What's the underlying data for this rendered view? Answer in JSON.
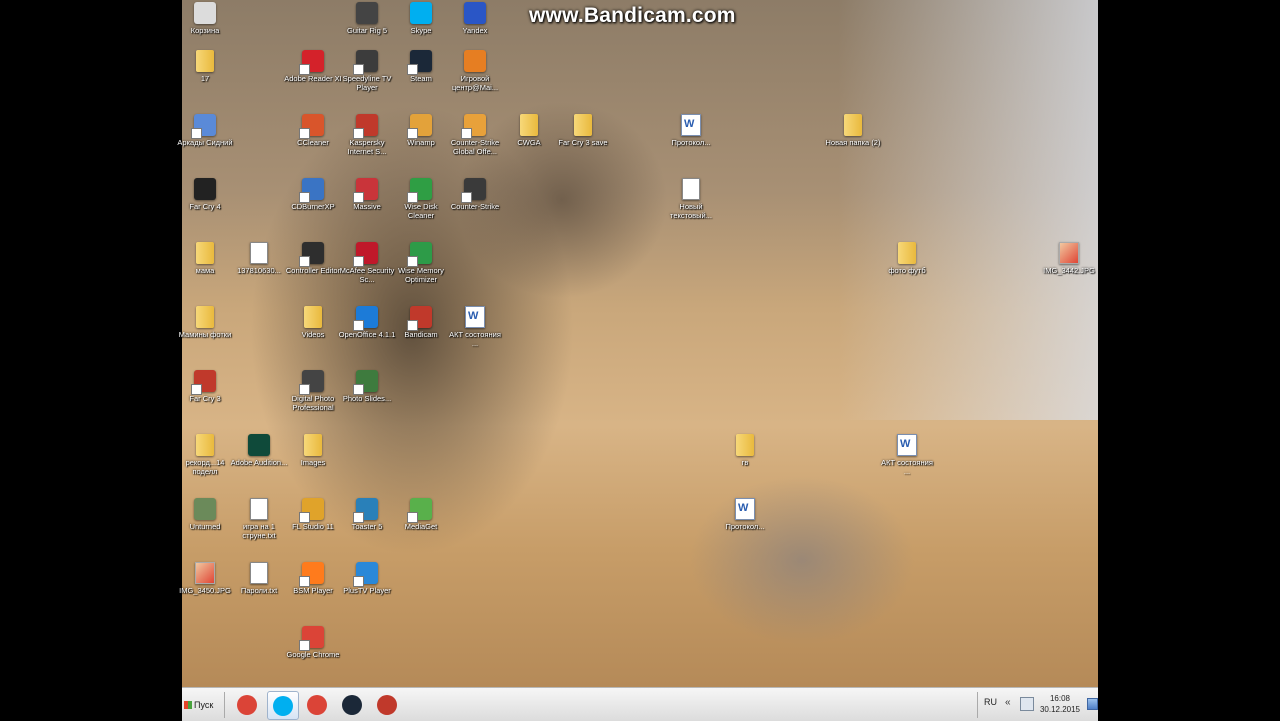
{
  "watermark": "www.Bandicam.com",
  "desktop_icons": [
    {
      "label": "Корзина",
      "type": "app",
      "color": "#dcdcdc"
    },
    {
      "label": "17",
      "type": "folder"
    },
    {
      "label": "Аркады Сидний",
      "type": "app",
      "color": "#5a8ad8",
      "shortcut": true
    },
    {
      "label": "Far Cry 4",
      "type": "app",
      "color": "#222222"
    },
    {
      "label": "мама",
      "type": "folder"
    },
    {
      "label": "Мамины фотки",
      "type": "folder"
    },
    {
      "label": "Far Cry 3",
      "type": "app",
      "color": "#c0392b",
      "shortcut": true
    },
    {
      "label": "рекорд...14 поделл",
      "type": "folder"
    },
    {
      "label": "Unturned",
      "type": "app",
      "color": "#6b8a5a"
    },
    {
      "label": "IMG_3450.JPG",
      "type": "image"
    },
    {
      "label": "Guitar Rig 5",
      "type": "app",
      "color": "#444444"
    },
    {
      "label": "Adobe Reader XI",
      "type": "app",
      "color": "#d4222a",
      "shortcut": true
    },
    {
      "label": "CCleaner",
      "type": "app",
      "color": "#d9552b",
      "shortcut": true
    },
    {
      "label": "CDBurnerXP",
      "type": "app",
      "color": "#3a74c4",
      "shortcut": true
    },
    {
      "label": "137810630...",
      "type": "doc"
    },
    {
      "label": "Adobe Audition...",
      "type": "app",
      "color": "#0f4a3a"
    },
    {
      "label": "игра на 1 струне.txt",
      "type": "doc"
    },
    {
      "label": "Пароли.txt",
      "type": "doc"
    },
    {
      "label": "Skype",
      "type": "app",
      "color": "#00aff0"
    },
    {
      "label": "Speedyline TV Player",
      "type": "app",
      "color": "#3c3c3c",
      "shortcut": true
    },
    {
      "label": "Kaspersky Internet S...",
      "type": "app",
      "color": "#c0392b",
      "shortcut": true
    },
    {
      "label": "Massive",
      "type": "app",
      "color": "#c9343a",
      "shortcut": true
    },
    {
      "label": "Controller Editor",
      "type": "app",
      "color": "#2e2e2e",
      "shortcut": true
    },
    {
      "label": "Videos",
      "type": "folder"
    },
    {
      "label": "Digital Photo Professional",
      "type": "app",
      "color": "#444444",
      "shortcut": true
    },
    {
      "label": "Images",
      "type": "folder"
    },
    {
      "label": "FL Studio 11",
      "type": "app",
      "color": "#e0a32a",
      "shortcut": true
    },
    {
      "label": "BSM Player",
      "type": "app",
      "color": "#ff7b1c",
      "shortcut": true
    },
    {
      "label": "Google Chrome",
      "type": "app",
      "color": "#db4437",
      "shortcut": true
    },
    {
      "label": "Yandex",
      "type": "app",
      "color": "#2a56c6"
    },
    {
      "label": "Steam",
      "type": "app",
      "color": "#1b2838",
      "shortcut": true
    },
    {
      "label": "Winamp",
      "type": "app",
      "color": "#e3a23a",
      "shortcut": true
    },
    {
      "label": "Wise Disk Cleaner",
      "type": "app",
      "color": "#2f9e44",
      "shortcut": true
    },
    {
      "label": "McAfee Security Sc...",
      "type": "app",
      "color": "#c0182a",
      "shortcut": true
    },
    {
      "label": "OpenOffice 4.1.1",
      "type": "app",
      "color": "#1c7bd8",
      "shortcut": true
    },
    {
      "label": "Photo Slides...",
      "type": "app",
      "color": "#3e7b3e",
      "shortcut": true
    },
    {
      "label": "Toaster 5",
      "type": "app",
      "color": "#2980b9",
      "shortcut": true
    },
    {
      "label": "MediaGet",
      "type": "app",
      "color": "#59b04b",
      "shortcut": true
    },
    {
      "label": "PlusTV Player",
      "type": "app",
      "color": "#2a88d8",
      "shortcut": true
    },
    {
      "label": "Игровой центр@Mai...",
      "type": "app",
      "color": "#e67e22"
    },
    {
      "label": "Counter-Strike Global Offe...",
      "type": "app",
      "color": "#e8a13a",
      "shortcut": true
    },
    {
      "label": "Counter-Strike",
      "type": "app",
      "color": "#3a3a3a",
      "shortcut": true
    },
    {
      "label": "Wise Memory Optimizer",
      "type": "app",
      "color": "#2d9b48",
      "shortcut": true
    },
    {
      "label": "Bandicam",
      "type": "app",
      "color": "#c0392b",
      "shortcut": true
    },
    {
      "label": "АКТ состояния ...",
      "type": "word"
    },
    {
      "label": "CWGA",
      "type": "folder"
    },
    {
      "label": "Far Cry 3 save",
      "type": "folder"
    },
    {
      "label": "Протокол...",
      "type": "word"
    },
    {
      "label": "Новый текстовый...",
      "type": "doc"
    },
    {
      "label": "Новая папка (2)",
      "type": "folder"
    },
    {
      "label": "фото футб",
      "type": "folder"
    },
    {
      "label": "IMG_3442.JPG",
      "type": "image"
    },
    {
      "label": "гв",
      "type": "folder"
    },
    {
      "label": "Протокол...",
      "type": "word"
    },
    {
      "label": "АКТ состояния ...",
      "type": "word"
    }
  ],
  "taskbar": {
    "start_label": "Пуск",
    "buttons": [
      {
        "name": "chrome",
        "color": "#db4437",
        "active": false
      },
      {
        "name": "skype",
        "color": "#00aff0",
        "active": true
      },
      {
        "name": "chrome",
        "color": "#db4437",
        "active": false
      },
      {
        "name": "steam",
        "color": "#1b2838",
        "active": false
      },
      {
        "name": "bandicam",
        "color": "#c0392b",
        "active": false
      }
    ],
    "language": "RU",
    "tray_arrow": "«",
    "clock_time": "16:08",
    "clock_date": "30.12.2015"
  }
}
